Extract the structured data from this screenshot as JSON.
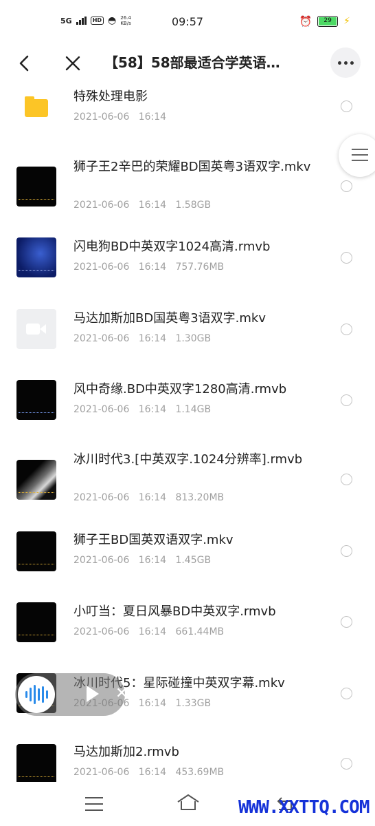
{
  "status_bar": {
    "network": "5G",
    "hd": "HD",
    "speed_value": "26.4",
    "speed_unit": "KB/s",
    "time": "09:57",
    "battery": "29"
  },
  "header": {
    "title": "【58】58部最适合学英语…"
  },
  "files": [
    {
      "name": "特殊处理电影",
      "date": "2021-06-06",
      "time": "16:14",
      "size": "",
      "thumb": "folder"
    },
    {
      "name": "狮子王2辛巴的荣耀BD国英粤3语双字.mkv",
      "date": "2021-06-06",
      "time": "16:14",
      "size": "1.58GB",
      "thumb": "black"
    },
    {
      "name": "闪电狗BD中英双字1024高清.rmvb",
      "date": "2021-06-06",
      "time": "16:14",
      "size": "757.76MB",
      "thumb": "blue"
    },
    {
      "name": "马达加斯加BD国英粤3语双字.mkv",
      "date": "2021-06-06",
      "time": "16:14",
      "size": "1.30GB",
      "thumb": "video-placeholder"
    },
    {
      "name": "风中奇缘.BD中英双字1280高清.rmvb",
      "date": "2021-06-06",
      "time": "16:14",
      "size": "1.14GB",
      "thumb": "black"
    },
    {
      "name": "冰川时代3.[中英双字.1024分辨率].rmvb",
      "date": "2021-06-06",
      "time": "16:14",
      "size": "813.20MB",
      "thumb": "ice"
    },
    {
      "name": "狮子王BD国英双语双字.mkv",
      "date": "2021-06-06",
      "time": "16:14",
      "size": "1.45GB",
      "thumb": "black"
    },
    {
      "name": "小叮当：夏日风暴BD中英双字.rmvb",
      "date": "2021-06-06",
      "time": "16:14",
      "size": "661.44MB",
      "thumb": "black"
    },
    {
      "name": "冰川时代5：星际碰撞中英双字幕.mkv",
      "date": "2021-06-06",
      "time": "16:14",
      "size": "1.33GB",
      "thumb": "black"
    },
    {
      "name": "马达加斯加2.rmvb",
      "date": "2021-06-06",
      "time": "16:14",
      "size": "453.69MB",
      "thumb": "black"
    }
  ],
  "watermark": "WWW.XXTTQ.COM",
  "colors": {
    "folder": "#fcc526",
    "meta_text": "#a0a0a0",
    "audio_accent": "#2a8bea",
    "watermark": "#1532d8"
  }
}
